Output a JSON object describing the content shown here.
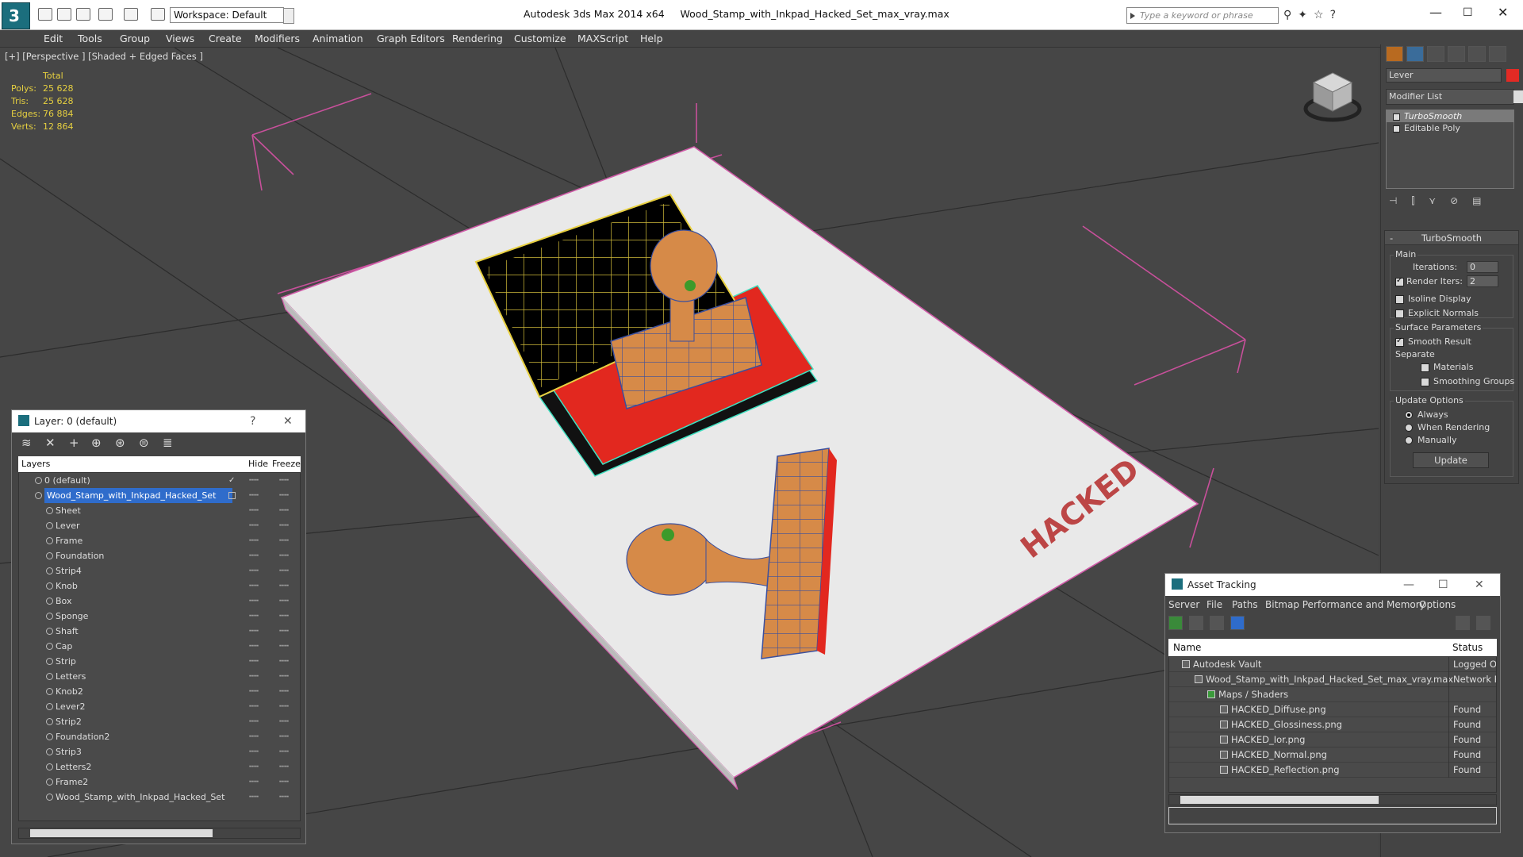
{
  "app": {
    "title": "Autodesk 3ds Max  2014 x64",
    "file": "Wood_Stamp_with_Inkpad_Hacked_Set_max_vray.max",
    "logo_text": "3",
    "workspace": "Workspace: Default",
    "search_placeholder": "Type a keyword or phrase"
  },
  "menu": [
    "Edit",
    "Tools",
    "Group",
    "Views",
    "Create",
    "Modifiers",
    "Animation",
    "Graph Editors",
    "Rendering",
    "Customize",
    "MAXScript",
    "Help"
  ],
  "viewport": {
    "label": "[+] [Perspective ] [Shaded + Edged Faces ]",
    "stats": {
      "header": "Total",
      "rows": [
        {
          "label": "Polys:",
          "value": "25 628"
        },
        {
          "label": "Tris:",
          "value": "25 628"
        },
        {
          "label": "Edges:",
          "value": "76 884"
        },
        {
          "label": "Verts:",
          "value": "12 864"
        }
      ]
    },
    "stamp_text": "HACKED"
  },
  "command_panel": {
    "object_name": "Lever",
    "color": "#e32a24",
    "modifier_list": "Modifier List",
    "stack": [
      "TurboSmooth",
      "Editable Poly"
    ],
    "rollout": {
      "title": "TurboSmooth",
      "main_label": "Main",
      "iterations_label": "Iterations:",
      "iterations": "0",
      "render_iters_label": "Render Iters:",
      "render_iters": "2",
      "isoline": "Isoline Display",
      "explicit": "Explicit Normals",
      "surface_label": "Surface Parameters",
      "smooth_result": "Smooth Result",
      "separate": "Separate",
      "materials": "Materials",
      "smoothing_groups": "Smoothing Groups",
      "update_label": "Update Options",
      "always": "Always",
      "when_rendering": "When Rendering",
      "manually": "Manually",
      "update_button": "Update"
    }
  },
  "layer_window": {
    "title": "Layer: 0 (default)",
    "help": "?",
    "col_layers": "Layers",
    "col_hide": "Hide",
    "col_freeze": "Freeze",
    "rows": [
      {
        "name": "0 (default)",
        "indent": 0
      },
      {
        "name": "Wood_Stamp_with_Inkpad_Hacked_Set",
        "indent": 0
      },
      {
        "name": "Sheet",
        "indent": 1
      },
      {
        "name": "Lever",
        "indent": 1
      },
      {
        "name": "Frame",
        "indent": 1
      },
      {
        "name": "Foundation",
        "indent": 1
      },
      {
        "name": "Strip4",
        "indent": 1
      },
      {
        "name": "Knob",
        "indent": 1
      },
      {
        "name": "Box",
        "indent": 1
      },
      {
        "name": "Sponge",
        "indent": 1
      },
      {
        "name": "Shaft",
        "indent": 1
      },
      {
        "name": "Cap",
        "indent": 1
      },
      {
        "name": "Strip",
        "indent": 1
      },
      {
        "name": "Letters",
        "indent": 1
      },
      {
        "name": "Knob2",
        "indent": 1
      },
      {
        "name": "Lever2",
        "indent": 1
      },
      {
        "name": "Strip2",
        "indent": 1
      },
      {
        "name": "Foundation2",
        "indent": 1
      },
      {
        "name": "Strip3",
        "indent": 1
      },
      {
        "name": "Letters2",
        "indent": 1
      },
      {
        "name": "Frame2",
        "indent": 1
      },
      {
        "name": "Wood_Stamp_with_Inkpad_Hacked_Set",
        "indent": 1
      }
    ]
  },
  "asset_window": {
    "title": "Asset Tracking",
    "menu": [
      "Server",
      "File",
      "Paths",
      "Bitmap Performance and Memory",
      "Options"
    ],
    "col_name": "Name",
    "col_status": "Status",
    "rows": [
      {
        "name": "Autodesk Vault",
        "status": "Logged O",
        "indent": 1
      },
      {
        "name": "Wood_Stamp_with_Inkpad_Hacked_Set_max_vray.max",
        "status": "Network P",
        "indent": 2
      },
      {
        "name": "Maps / Shaders",
        "status": "",
        "indent": 3
      },
      {
        "name": "HACKED_Diffuse.png",
        "status": "Found",
        "indent": 4
      },
      {
        "name": "HACKED_Glossiness.png",
        "status": "Found",
        "indent": 4
      },
      {
        "name": "HACKED_Ior.png",
        "status": "Found",
        "indent": 4
      },
      {
        "name": "HACKED_Normal.png",
        "status": "Found",
        "indent": 4
      },
      {
        "name": "HACKED_Reflection.png",
        "status": "Found",
        "indent": 4
      }
    ]
  }
}
